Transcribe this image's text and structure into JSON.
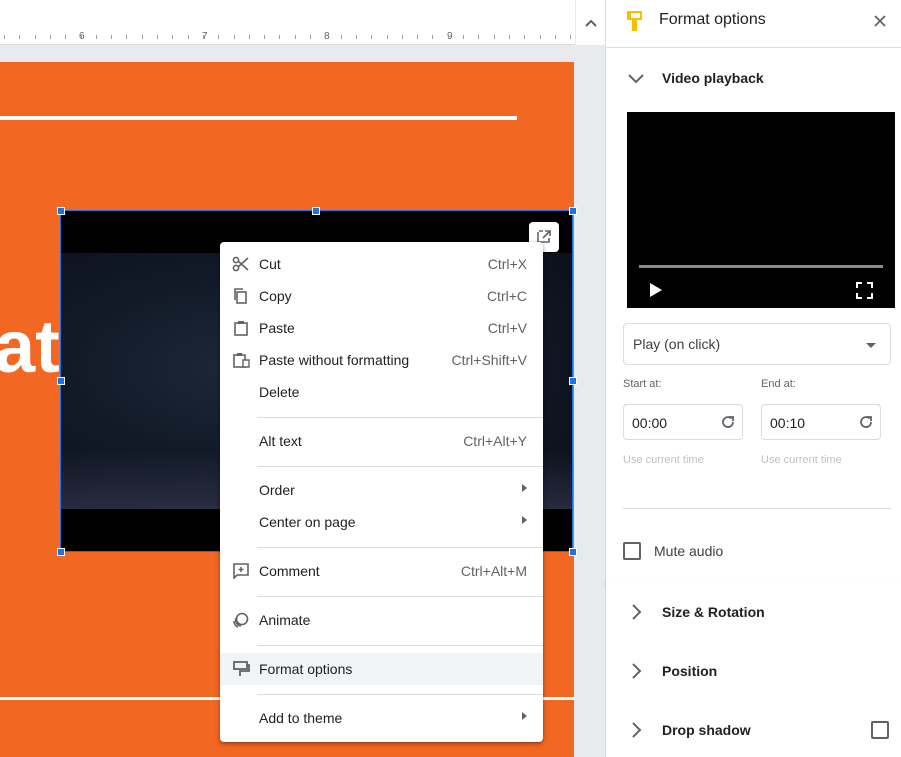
{
  "ruler": {
    "numbers": [
      "6",
      "7",
      "8",
      "9"
    ]
  },
  "slide": {
    "title_fragment": "at",
    "background_color": "#f26722"
  },
  "context_menu": {
    "items": [
      {
        "label": "Cut",
        "shortcut": "Ctrl+X",
        "icon": "scissors-icon"
      },
      {
        "label": "Copy",
        "shortcut": "Ctrl+C",
        "icon": "copy-icon"
      },
      {
        "label": "Paste",
        "shortcut": "Ctrl+V",
        "icon": "clipboard-icon"
      },
      {
        "label": "Paste without formatting",
        "shortcut": "Ctrl+Shift+V",
        "icon": "clipboard-plain-icon"
      },
      {
        "label": "Delete",
        "shortcut": ""
      },
      {
        "label": "Alt text",
        "shortcut": "Ctrl+Alt+Y"
      },
      {
        "label": "Order",
        "submenu": true
      },
      {
        "label": "Center on page",
        "submenu": true
      },
      {
        "label": "Comment",
        "shortcut": "Ctrl+Alt+M",
        "icon": "comment-add-icon"
      },
      {
        "label": "Animate",
        "icon": "animate-icon"
      },
      {
        "label": "Format options",
        "icon": "format-paint-icon",
        "highlighted": true
      },
      {
        "label": "Add to theme",
        "submenu": true
      }
    ]
  },
  "sidebar": {
    "title": "Format options",
    "accent_color": "#fbbc04",
    "video_playback": {
      "label": "Video playback",
      "play_mode": "Play (on click)",
      "start_label": "Start at:",
      "start_value": "00:00",
      "end_label": "End at:",
      "end_value": "00:10",
      "use_current_time": "Use current time",
      "mute_label": "Mute audio",
      "mute_checked": false
    },
    "sections": [
      {
        "label": "Size & Rotation"
      },
      {
        "label": "Position"
      },
      {
        "label": "Drop shadow",
        "checked": false
      }
    ]
  }
}
